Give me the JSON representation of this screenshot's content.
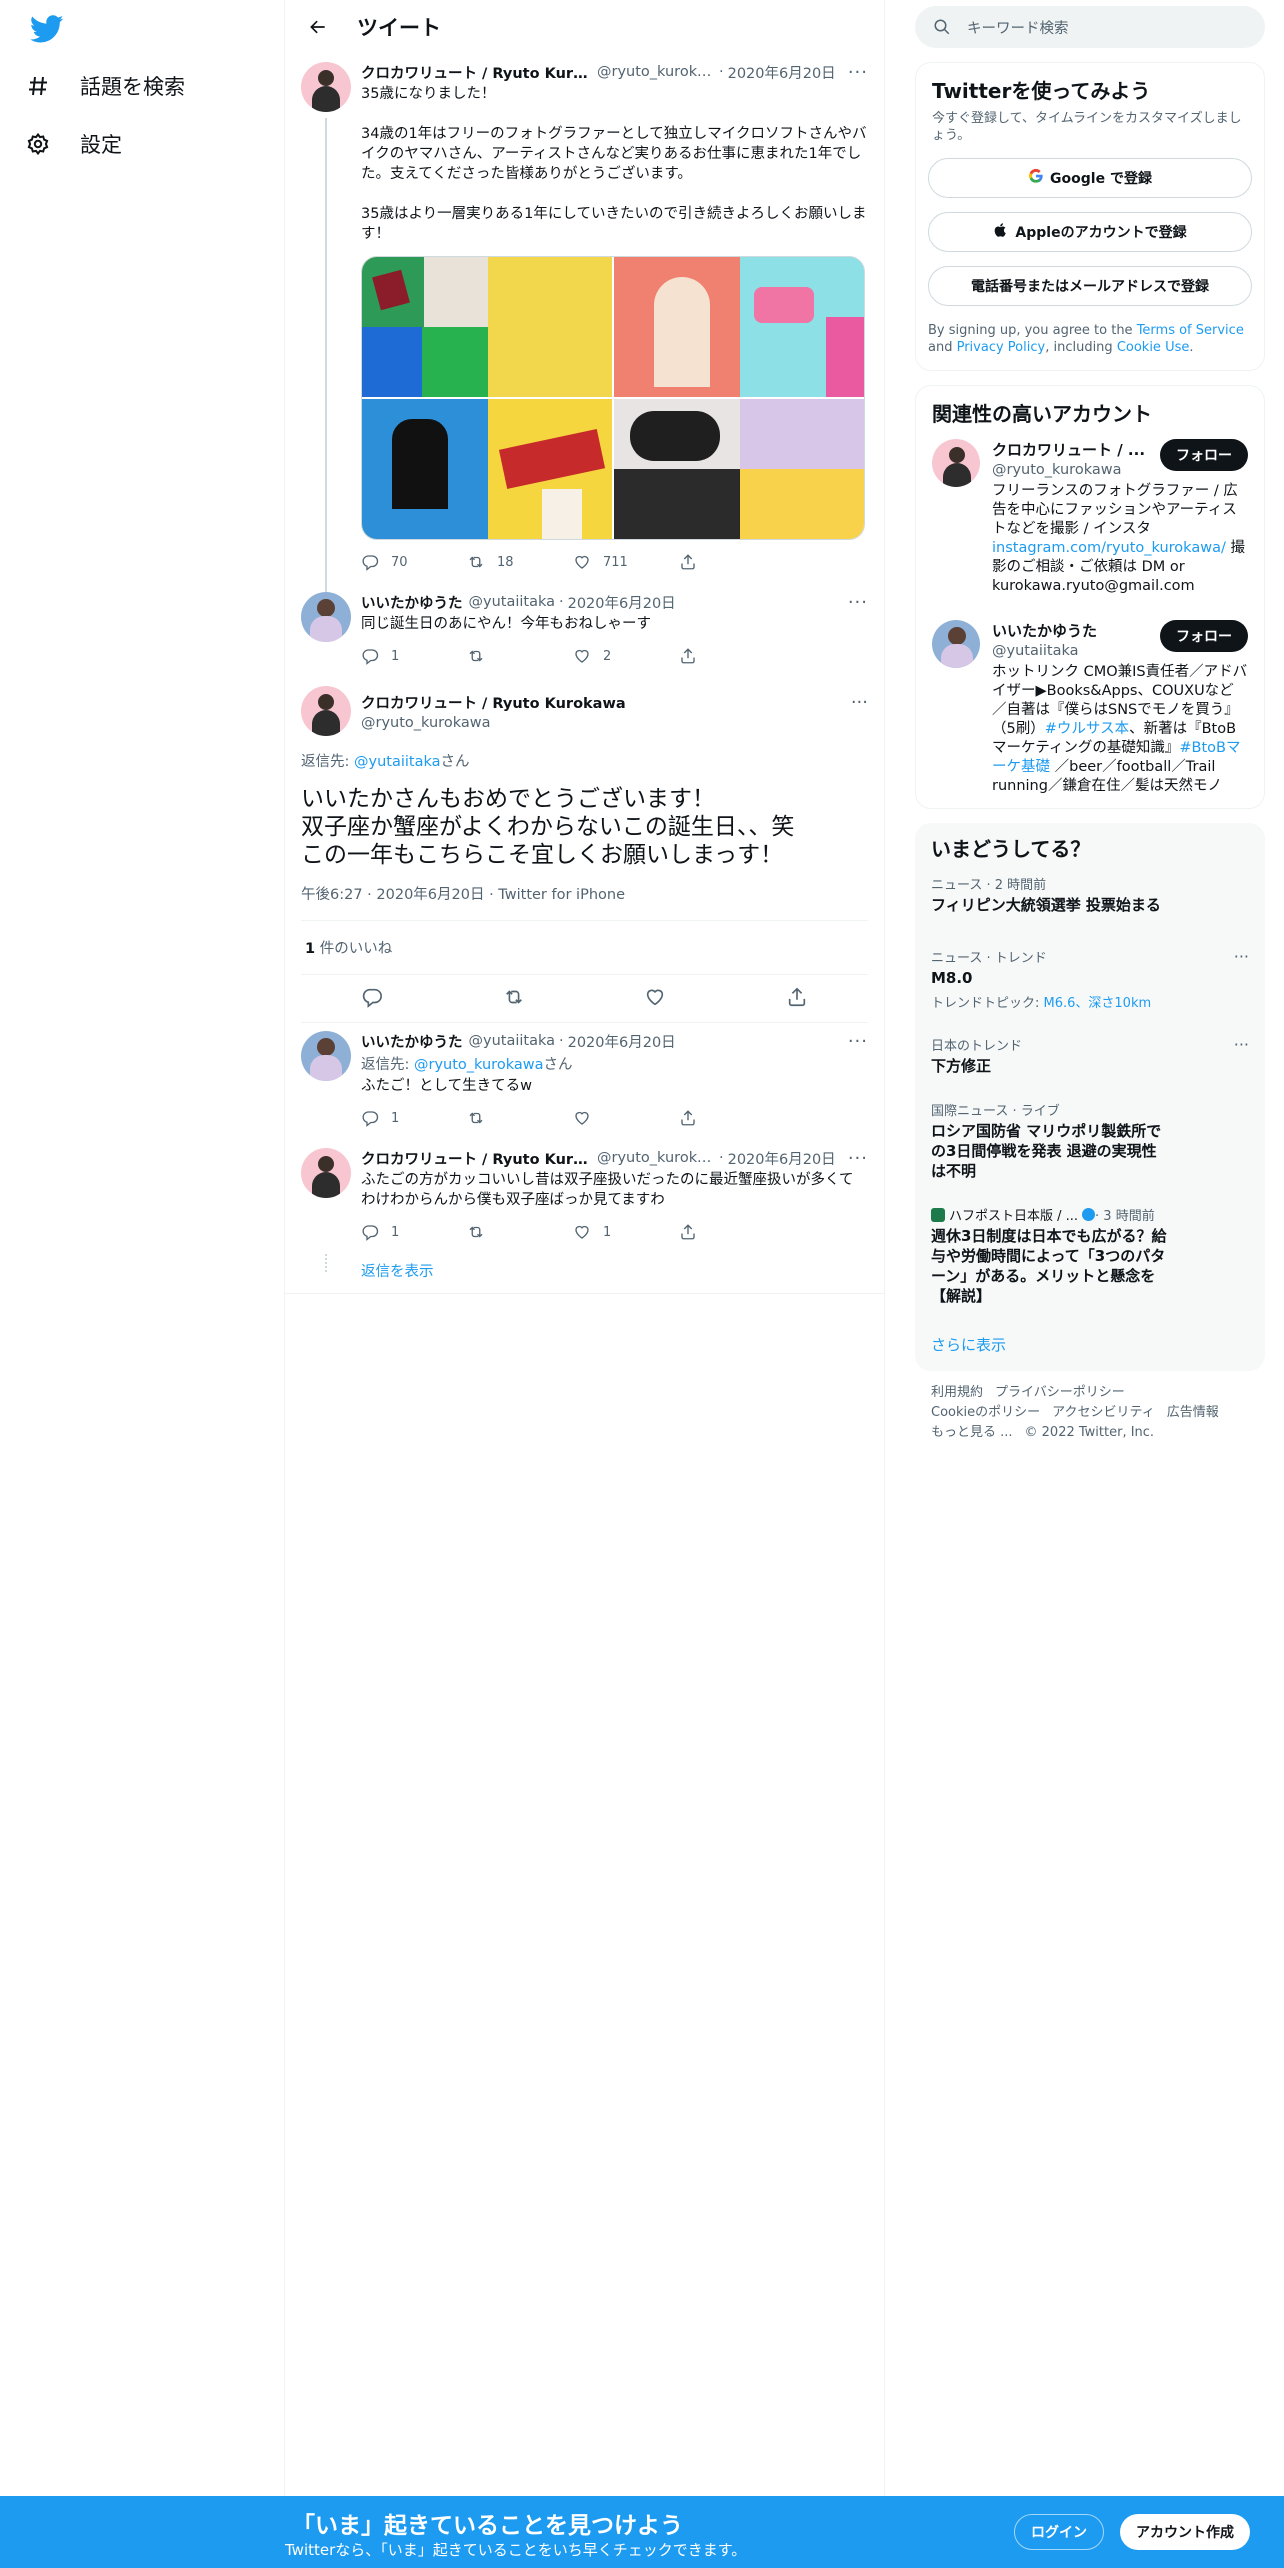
{
  "nav": {
    "explore_label": "話題を検索",
    "settings_label": "設定"
  },
  "header": {
    "title": "ツイート"
  },
  "tweets": {
    "t1": {
      "name": "クロカワリュート / Ryuto Kurok...",
      "handle": "@ryuto_kuroka...",
      "date": "2020年6月20日",
      "p1": "35歳になりました！",
      "p2": "34歳の1年はフリーのフォトグラファーとして独立しマイクロソフトさんやバイクのヤマハさん、アーティストさんなど実りあるお仕事に恵まれた1年でした。支えてくださった皆様ありがとうございます。",
      "p3": "35歳はより一層実りある1年にしていきたいので引き続きよろしくお願いします！",
      "replies": "70",
      "retweets": "18",
      "likes": "711"
    },
    "t2": {
      "name": "いいたかゆうた",
      "handle": "@yutaiitaka",
      "date": "2020年6月20日",
      "text": "同じ誕生日のあにやん！今年もおねしゃーす",
      "replies": "1",
      "retweets": "",
      "likes": "2"
    },
    "focus": {
      "name": "クロカワリュート / Ryuto Kurokawa",
      "handle": "@ryuto_kurokawa",
      "reply_prefix": "返信先: ",
      "reply_to": "@yutaiitaka",
      "reply_suffix": "さん",
      "line1": "いいたかさんもおめでとうございます！",
      "line2": "双子座か蟹座がよくわからないこの誕生日、、笑",
      "line3": "この一年もこちらこそ宜しくお願いしまっす！",
      "meta": "午後6:27 · 2020年6月20日 · Twitter for iPhone",
      "likes_count": "1",
      "likes_label": " 件のいいね"
    },
    "t3": {
      "name": "いいたかゆうた",
      "handle": "@yutaiitaka",
      "date": "2020年6月20日",
      "reply_prefix": "返信先: ",
      "reply_to": "@ryuto_kurokawa",
      "reply_suffix": "さん",
      "text": "ふたご！として生きてるw",
      "replies": "1",
      "retweets": "",
      "likes": ""
    },
    "t4": {
      "name": "クロカワリュート / Ryuto Kurok...",
      "handle": "@ryuto_kuroka...",
      "date": "2020年6月20日",
      "text": "ふたごの方がカッコいいし昔は双子座扱いだったのに最近蟹座扱いが多くてわけわからんから僕も双子座ばっか見てますわ",
      "replies": "1",
      "retweets": "",
      "likes": "1"
    },
    "show_replies": "返信を表示"
  },
  "right": {
    "search_placeholder": "キーワード検索",
    "signup": {
      "title": "Twitterを使ってみよう",
      "subtitle": "今すぐ登録して、タイムラインをカスタマイズしましょう。",
      "google": "Google で登録",
      "apple": "Appleのアカウントで登録",
      "phone": "電話番号またはメールアドレスで登録",
      "legal_prefix": "By signing up, you agree to the ",
      "terms": "Terms of Service",
      "and": " and ",
      "privacy": "Privacy Policy",
      "including": ", including ",
      "cookie": "Cookie Use",
      "period": "."
    },
    "related": {
      "title": "関連性の高いアカウント",
      "follow_label": "フォロー",
      "a1_name": "クロカワリュート / ...",
      "a1_handle": "@ryuto_kurokawa",
      "a1_bio1": "フリーランスのフォトグラファー / 広告を中心にファッションやアーティストなどを撮影 / インスタ ",
      "a1_link": "instagram.com/ryuto_kurokawa/",
      "a1_bio2": " 撮影のご相談・ご依頼は DM or kurokawa.ryuto@gmail.com",
      "a2_name": "いいたかゆうた",
      "a2_handle": "@yutaiitaka",
      "a2_bio1": "ホットリンク CMO兼IS責任者／アドバイザー▶Books&Apps、COUXUなど／自著は『僕らはSNSでモノを買う』（5刷）",
      "a2_tag1": "#ウルサス本",
      "a2_bio2": "、新著は『BtoBマーケティングの基礎知識』",
      "a2_tag2": "#BtoBマーケ基礎",
      "a2_bio3": " ／beer／football／Trail running／鎌倉在住／髪は天然モノ"
    },
    "trends": {
      "title": "いまどうしてる？",
      "items": [
        {
          "cat": "ニュース · 2 時間前",
          "title": "フィリピン大統領選挙 投票始まる"
        },
        {
          "cat": "ニュース · トレンド",
          "title": "M8.0",
          "sub_prefix": "トレンドトピック: ",
          "sub_link": "M6.6、深さ10km"
        },
        {
          "cat": "日本のトレンド",
          "title": "下方修正"
        },
        {
          "cat": "国際ニュース · ライブ",
          "title": "ロシア国防省 マリウポリ製鉄所での3日間停戦を発表 退避の実現性は不明"
        },
        {
          "cat_name": "ハフポスト日本版 / ...",
          "cat_time": " · 3 時間前",
          "title": "週休3日制度は日本でも広がる？給与や労働時間によって「3つのパターン」がある。メリットと懸念を【解説】"
        }
      ],
      "show_more": "さらに表示"
    },
    "footer": {
      "terms": "利用規約",
      "privacy": "プライバシーポリシー",
      "cookie": "Cookieのポリシー",
      "accessibility": "アクセシビリティ",
      "ads": "広告情報",
      "more": "もっと見る ...",
      "copyright": "© 2022 Twitter, Inc."
    }
  },
  "bottom": {
    "title": "「いま」起きていることを見つけよう",
    "subtitle": "Twitterなら、「いま」起きていることをいち早くチェックできます。",
    "login": "ログイン",
    "signup": "アカウント作成"
  },
  "colors": {
    "accent": "#1d9bf0",
    "text": "#0f1419",
    "muted": "#536471"
  }
}
